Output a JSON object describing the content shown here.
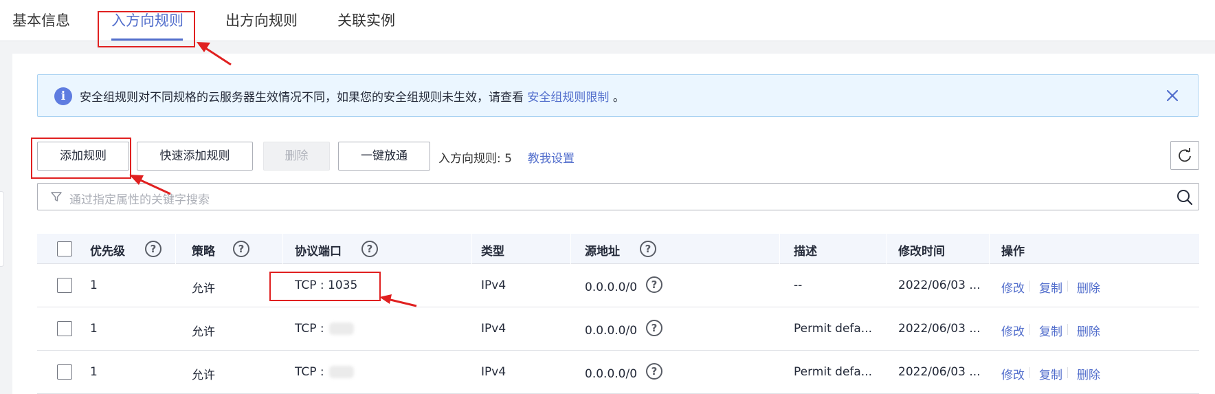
{
  "tabs": [
    {
      "label": "基本信息",
      "active": false
    },
    {
      "label": "入方向规则",
      "active": true
    },
    {
      "label": "出方向规则",
      "active": false
    },
    {
      "label": "关联实例",
      "active": false
    }
  ],
  "alert": {
    "text": "安全组规则对不同规格的云服务器生效情况不同，如果您的安全组规则未生效，请查看",
    "link": "安全组规则限制",
    "suffix": "。",
    "icon": "info-icon"
  },
  "toolbar": {
    "add_rule": "添加规则",
    "quick_add": "快速添加规则",
    "delete": "删除",
    "one_click": "一键放通",
    "rule_count": "入方向规则: 5",
    "teach_link": "教我设置"
  },
  "search": {
    "placeholder": "通过指定属性的关键字搜索"
  },
  "table": {
    "headers": {
      "priority": "优先级",
      "policy": "策略",
      "protocol_port": "协议端口",
      "type": "类型",
      "source": "源地址",
      "description": "描述",
      "modified": "修改时间",
      "actions": "操作"
    },
    "rows": [
      {
        "priority": "1",
        "policy": "允许",
        "protocol_port": "TCP : 1035",
        "type": "IPv4",
        "source": "0.0.0.0/0",
        "description": "--",
        "modified": "2022/06/03 ..."
      },
      {
        "priority": "1",
        "policy": "允许",
        "protocol_port": "TCP : ",
        "type": "IPv4",
        "source": "0.0.0.0/0",
        "description": "Permit defa...",
        "modified": "2022/06/03 ..."
      },
      {
        "priority": "1",
        "policy": "允许",
        "protocol_port": "TCP : ",
        "type": "IPv4",
        "source": "0.0.0.0/0",
        "description": "Permit defa...",
        "modified": "2022/06/03 ..."
      }
    ],
    "row_actions": {
      "edit": "修改",
      "copy": "复制",
      "delete": "删除"
    }
  },
  "colors": {
    "accent": "#526ecc",
    "annotation": "#e02020",
    "alert_bg": "#ebf6ff"
  }
}
